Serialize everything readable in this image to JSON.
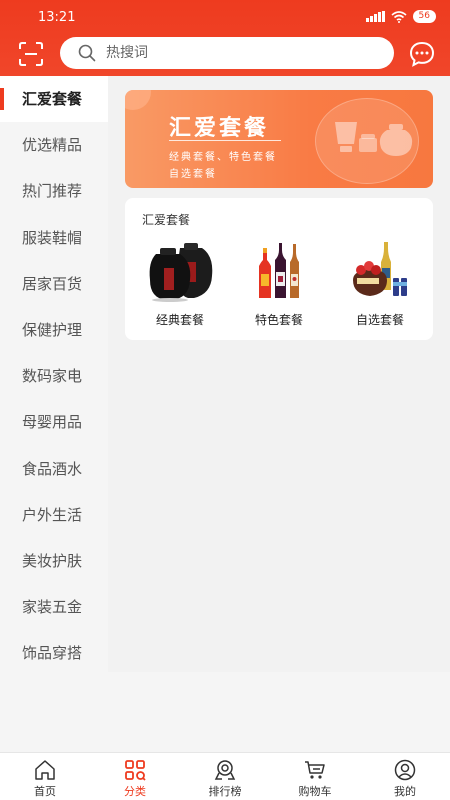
{
  "status_bar": {
    "time": "13:21",
    "battery": "56"
  },
  "search": {
    "placeholder": "热搜词"
  },
  "sidebar": {
    "items": [
      {
        "label": "汇爱套餐",
        "active": true
      },
      {
        "label": "优选精品"
      },
      {
        "label": "热门推荐"
      },
      {
        "label": "服装鞋帽"
      },
      {
        "label": "居家百货"
      },
      {
        "label": "保健护理"
      },
      {
        "label": "数码家电"
      },
      {
        "label": "母婴用品"
      },
      {
        "label": "食品酒水"
      },
      {
        "label": "户外生活"
      },
      {
        "label": "美妆护肤"
      },
      {
        "label": "家装五金"
      },
      {
        "label": "饰品穿搭"
      }
    ]
  },
  "banner": {
    "title": "汇爱套餐",
    "subtitle_line1": "经典套餐、特色套餐",
    "subtitle_line2": "自选套餐"
  },
  "packages": {
    "title": "汇爱套餐",
    "items": [
      {
        "label": "经典套餐",
        "icon": "liquor-jars-icon"
      },
      {
        "label": "特色套餐",
        "icon": "wine-bottles-icon"
      },
      {
        "label": "自选套餐",
        "icon": "gift-basket-icon"
      }
    ]
  },
  "tabbar": {
    "items": [
      {
        "label": "首页",
        "icon": "home-icon"
      },
      {
        "label": "分类",
        "icon": "category-icon",
        "active": true
      },
      {
        "label": "排行榜",
        "icon": "ranking-icon"
      },
      {
        "label": "购物车",
        "icon": "cart-icon"
      },
      {
        "label": "我的",
        "icon": "profile-icon"
      }
    ]
  },
  "colors": {
    "brand": "#ee3b1f",
    "banner_start": "#f99a65",
    "banner_end": "#f7783f"
  }
}
